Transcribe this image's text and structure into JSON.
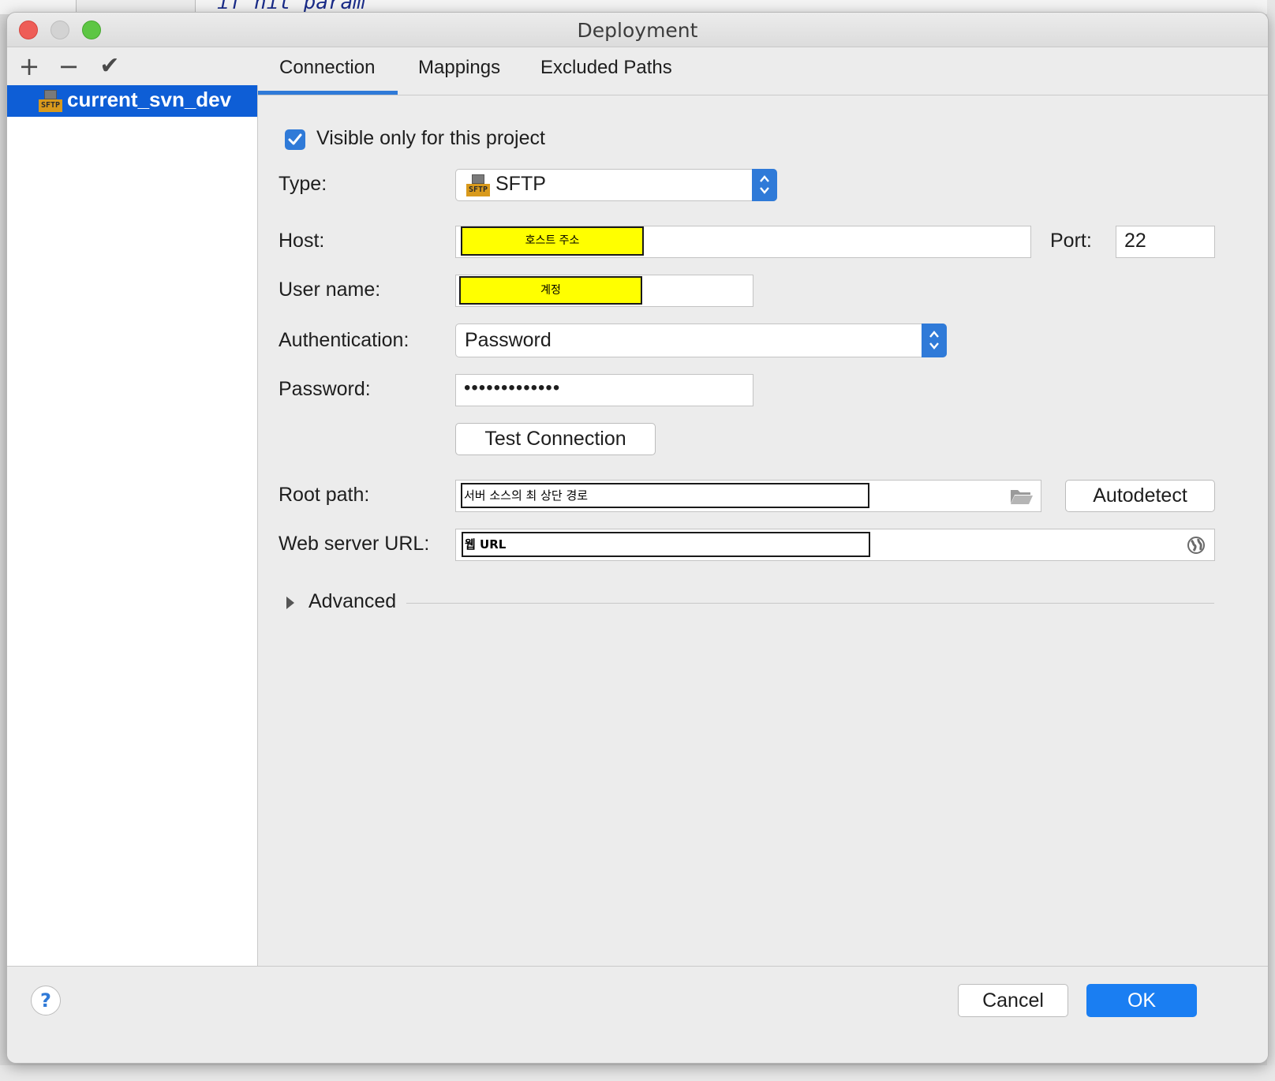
{
  "background": {
    "code_text": "if nit_param"
  },
  "window": {
    "title": "Deployment"
  },
  "toolbar": {
    "add_label": "+",
    "remove_label": "−",
    "apply_label": "✔"
  },
  "servers": [
    {
      "name": "current_svn_dev",
      "selected": true,
      "icon_label": "SFTP"
    }
  ],
  "tabs": [
    {
      "label": "Connection",
      "active": true
    },
    {
      "label": "Mappings",
      "active": false
    },
    {
      "label": "Excluded Paths",
      "active": false
    }
  ],
  "connection": {
    "visible_only_label": "Visible only for this project",
    "visible_only_checked": true,
    "type_label": "Type:",
    "type_value": "SFTP",
    "type_icon_label": "SFTP",
    "host_label": "Host:",
    "host_value": "호스트 주소",
    "port_label": "Port:",
    "port_value": "22",
    "username_label": "User name:",
    "username_value": "계정",
    "auth_label": "Authentication:",
    "auth_value": "Password",
    "password_label": "Password:",
    "password_value": "•••••••••••••",
    "test_connection_label": "Test Connection",
    "root_path_label": "Root path:",
    "root_path_value": "서버 소스의 최 상단 경로",
    "autodetect_label": "Autodetect",
    "web_url_label": "Web server URL:",
    "web_url_value": "웹 URL",
    "advanced_label": "Advanced"
  },
  "footer": {
    "help_label": "?",
    "cancel_label": "Cancel",
    "ok_label": "OK"
  },
  "colors": {
    "accent": "#2f7ad8",
    "selection": "#0e5ed6",
    "highlight": "#ffff00"
  }
}
